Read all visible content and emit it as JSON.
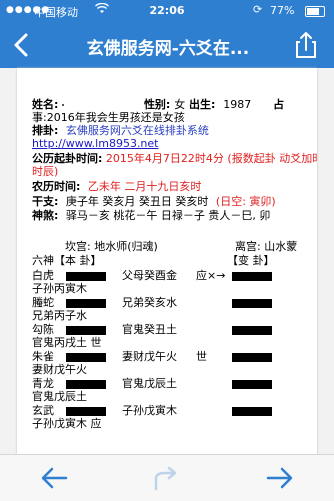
{
  "status_bar": {
    "carrier": "中国移动",
    "time": "22:06",
    "battery": "77%",
    "battery_level": 0.77,
    "icons": [
      "signal-icon",
      "wifi-icon",
      "rotation-lock-icon",
      "battery-icon"
    ]
  },
  "nav": {
    "title": "玄佛服务网-六爻在...",
    "back_icon": "chevron-left-icon",
    "share_icon": "share-icon"
  },
  "doc": {
    "name_label": "姓名:",
    "gender_label": "性别:",
    "gender_value": "女",
    "birth_label": "出生:",
    "birth_value": "1987",
    "divine_label": "占",
    "event": "事:2016年我会生男孩还是女孩",
    "paipan_label": "排卦:",
    "paipan_value": "玄佛服务网六爻在线排卦系统",
    "url": "http://www.lm8953.net",
    "gl_label": "公历起卦时间:",
    "gl_value": "2015年4月7日22时4分",
    "gl_note": "(报数起卦 动爻加时辰)",
    "nl_label": "农历时间:",
    "nl_value": "乙未年 二月十九日亥时",
    "gz_label": "干支:",
    "gz_value": "庚子年 癸亥月 癸丑日 癸亥时",
    "gz_note": "(日空: 寅卯)",
    "ss_label": "神煞:",
    "ss_value": "驿马－亥  桃花－午  日禄－子  贵人－巳, 卯",
    "palace_left": "坎宫: 地水师(归魂)",
    "palace_right": "离宫: 山水蒙",
    "header_left": "六神【本    卦】",
    "header_right": "【变    卦】"
  },
  "lines": [
    {
      "god": "白虎",
      "mid": "父母癸酉金",
      "mark": "应×→",
      "sub": "子孙丙寅木"
    },
    {
      "god": "螣蛇",
      "mid": "兄弟癸亥水",
      "mark": "",
      "sub": "兄弟丙子水"
    },
    {
      "god": "勾陈",
      "mid": "官鬼癸丑土",
      "mark": "",
      "sub": "官鬼丙戌土  世"
    },
    {
      "god": "朱雀",
      "mid": "妻财戊午火",
      "mark": "世",
      "sub": "妻财戊午火"
    },
    {
      "god": "青龙",
      "mid": "官鬼戊辰土",
      "mark": "",
      "sub": "官鬼戊辰土"
    },
    {
      "god": "玄武",
      "mid": "子孙戊寅木",
      "mark": "",
      "sub": "子孙戊寅木  应"
    }
  ],
  "toolbar": {
    "back_icon": "arrow-left-icon",
    "share_icon": "share-arrow-icon",
    "forward_icon": "arrow-right-icon"
  }
}
